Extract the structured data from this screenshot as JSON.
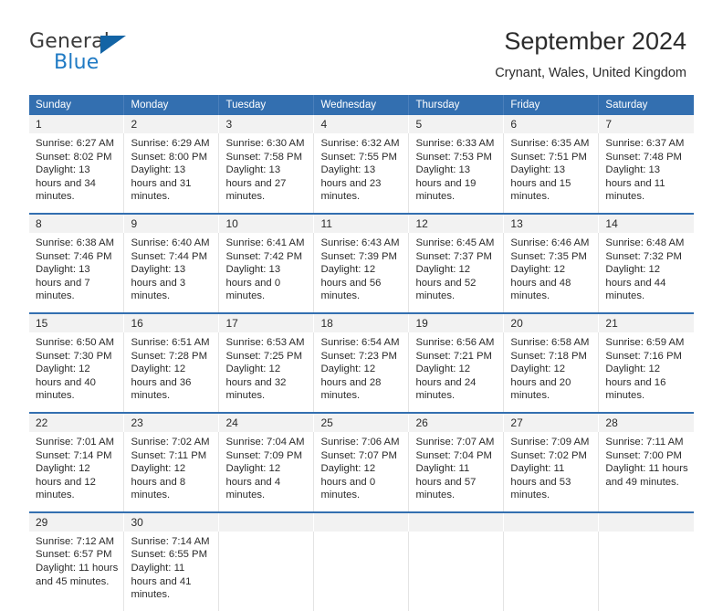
{
  "brand": {
    "name_top": "General",
    "name_bottom": "Blue",
    "triangle_color": "#1364a5",
    "blue_color": "#1f7ac4",
    "gray_color": "#3b3b3b"
  },
  "header": {
    "title": "September 2024",
    "subtitle": "Crynant, Wales, United Kingdom"
  },
  "theme": {
    "header_blue": "#336fb0",
    "daynum_band": "#f2f2f2",
    "cell_border": "#e4e4e4",
    "text": "#2b2b2b"
  },
  "weekday_headers": [
    "Sunday",
    "Monday",
    "Tuesday",
    "Wednesday",
    "Thursday",
    "Friday",
    "Saturday"
  ],
  "weeks": [
    {
      "days": [
        {
          "num": "1",
          "sunrise": "Sunrise: 6:27 AM",
          "sunset": "Sunset: 8:02 PM",
          "daylight": "Daylight: 13 hours and 34 minutes."
        },
        {
          "num": "2",
          "sunrise": "Sunrise: 6:29 AM",
          "sunset": "Sunset: 8:00 PM",
          "daylight": "Daylight: 13 hours and 31 minutes."
        },
        {
          "num": "3",
          "sunrise": "Sunrise: 6:30 AM",
          "sunset": "Sunset: 7:58 PM",
          "daylight": "Daylight: 13 hours and 27 minutes."
        },
        {
          "num": "4",
          "sunrise": "Sunrise: 6:32 AM",
          "sunset": "Sunset: 7:55 PM",
          "daylight": "Daylight: 13 hours and 23 minutes."
        },
        {
          "num": "5",
          "sunrise": "Sunrise: 6:33 AM",
          "sunset": "Sunset: 7:53 PM",
          "daylight": "Daylight: 13 hours and 19 minutes."
        },
        {
          "num": "6",
          "sunrise": "Sunrise: 6:35 AM",
          "sunset": "Sunset: 7:51 PM",
          "daylight": "Daylight: 13 hours and 15 minutes."
        },
        {
          "num": "7",
          "sunrise": "Sunrise: 6:37 AM",
          "sunset": "Sunset: 7:48 PM",
          "daylight": "Daylight: 13 hours and 11 minutes."
        }
      ]
    },
    {
      "days": [
        {
          "num": "8",
          "sunrise": "Sunrise: 6:38 AM",
          "sunset": "Sunset: 7:46 PM",
          "daylight": "Daylight: 13 hours and 7 minutes."
        },
        {
          "num": "9",
          "sunrise": "Sunrise: 6:40 AM",
          "sunset": "Sunset: 7:44 PM",
          "daylight": "Daylight: 13 hours and 3 minutes."
        },
        {
          "num": "10",
          "sunrise": "Sunrise: 6:41 AM",
          "sunset": "Sunset: 7:42 PM",
          "daylight": "Daylight: 13 hours and 0 minutes."
        },
        {
          "num": "11",
          "sunrise": "Sunrise: 6:43 AM",
          "sunset": "Sunset: 7:39 PM",
          "daylight": "Daylight: 12 hours and 56 minutes."
        },
        {
          "num": "12",
          "sunrise": "Sunrise: 6:45 AM",
          "sunset": "Sunset: 7:37 PM",
          "daylight": "Daylight: 12 hours and 52 minutes."
        },
        {
          "num": "13",
          "sunrise": "Sunrise: 6:46 AM",
          "sunset": "Sunset: 7:35 PM",
          "daylight": "Daylight: 12 hours and 48 minutes."
        },
        {
          "num": "14",
          "sunrise": "Sunrise: 6:48 AM",
          "sunset": "Sunset: 7:32 PM",
          "daylight": "Daylight: 12 hours and 44 minutes."
        }
      ]
    },
    {
      "days": [
        {
          "num": "15",
          "sunrise": "Sunrise: 6:50 AM",
          "sunset": "Sunset: 7:30 PM",
          "daylight": "Daylight: 12 hours and 40 minutes."
        },
        {
          "num": "16",
          "sunrise": "Sunrise: 6:51 AM",
          "sunset": "Sunset: 7:28 PM",
          "daylight": "Daylight: 12 hours and 36 minutes."
        },
        {
          "num": "17",
          "sunrise": "Sunrise: 6:53 AM",
          "sunset": "Sunset: 7:25 PM",
          "daylight": "Daylight: 12 hours and 32 minutes."
        },
        {
          "num": "18",
          "sunrise": "Sunrise: 6:54 AM",
          "sunset": "Sunset: 7:23 PM",
          "daylight": "Daylight: 12 hours and 28 minutes."
        },
        {
          "num": "19",
          "sunrise": "Sunrise: 6:56 AM",
          "sunset": "Sunset: 7:21 PM",
          "daylight": "Daylight: 12 hours and 24 minutes."
        },
        {
          "num": "20",
          "sunrise": "Sunrise: 6:58 AM",
          "sunset": "Sunset: 7:18 PM",
          "daylight": "Daylight: 12 hours and 20 minutes."
        },
        {
          "num": "21",
          "sunrise": "Sunrise: 6:59 AM",
          "sunset": "Sunset: 7:16 PM",
          "daylight": "Daylight: 12 hours and 16 minutes."
        }
      ]
    },
    {
      "days": [
        {
          "num": "22",
          "sunrise": "Sunrise: 7:01 AM",
          "sunset": "Sunset: 7:14 PM",
          "daylight": "Daylight: 12 hours and 12 minutes."
        },
        {
          "num": "23",
          "sunrise": "Sunrise: 7:02 AM",
          "sunset": "Sunset: 7:11 PM",
          "daylight": "Daylight: 12 hours and 8 minutes."
        },
        {
          "num": "24",
          "sunrise": "Sunrise: 7:04 AM",
          "sunset": "Sunset: 7:09 PM",
          "daylight": "Daylight: 12 hours and 4 minutes."
        },
        {
          "num": "25",
          "sunrise": "Sunrise: 7:06 AM",
          "sunset": "Sunset: 7:07 PM",
          "daylight": "Daylight: 12 hours and 0 minutes."
        },
        {
          "num": "26",
          "sunrise": "Sunrise: 7:07 AM",
          "sunset": "Sunset: 7:04 PM",
          "daylight": "Daylight: 11 hours and 57 minutes."
        },
        {
          "num": "27",
          "sunrise": "Sunrise: 7:09 AM",
          "sunset": "Sunset: 7:02 PM",
          "daylight": "Daylight: 11 hours and 53 minutes."
        },
        {
          "num": "28",
          "sunrise": "Sunrise: 7:11 AM",
          "sunset": "Sunset: 7:00 PM",
          "daylight": "Daylight: 11 hours and 49 minutes."
        }
      ]
    },
    {
      "days": [
        {
          "num": "29",
          "sunrise": "Sunrise: 7:12 AM",
          "sunset": "Sunset: 6:57 PM",
          "daylight": "Daylight: 11 hours and 45 minutes."
        },
        {
          "num": "30",
          "sunrise": "Sunrise: 7:14 AM",
          "sunset": "Sunset: 6:55 PM",
          "daylight": "Daylight: 11 hours and 41 minutes."
        },
        {
          "num": "",
          "sunrise": "",
          "sunset": "",
          "daylight": ""
        },
        {
          "num": "",
          "sunrise": "",
          "sunset": "",
          "daylight": ""
        },
        {
          "num": "",
          "sunrise": "",
          "sunset": "",
          "daylight": ""
        },
        {
          "num": "",
          "sunrise": "",
          "sunset": "",
          "daylight": ""
        },
        {
          "num": "",
          "sunrise": "",
          "sunset": "",
          "daylight": ""
        }
      ]
    }
  ]
}
